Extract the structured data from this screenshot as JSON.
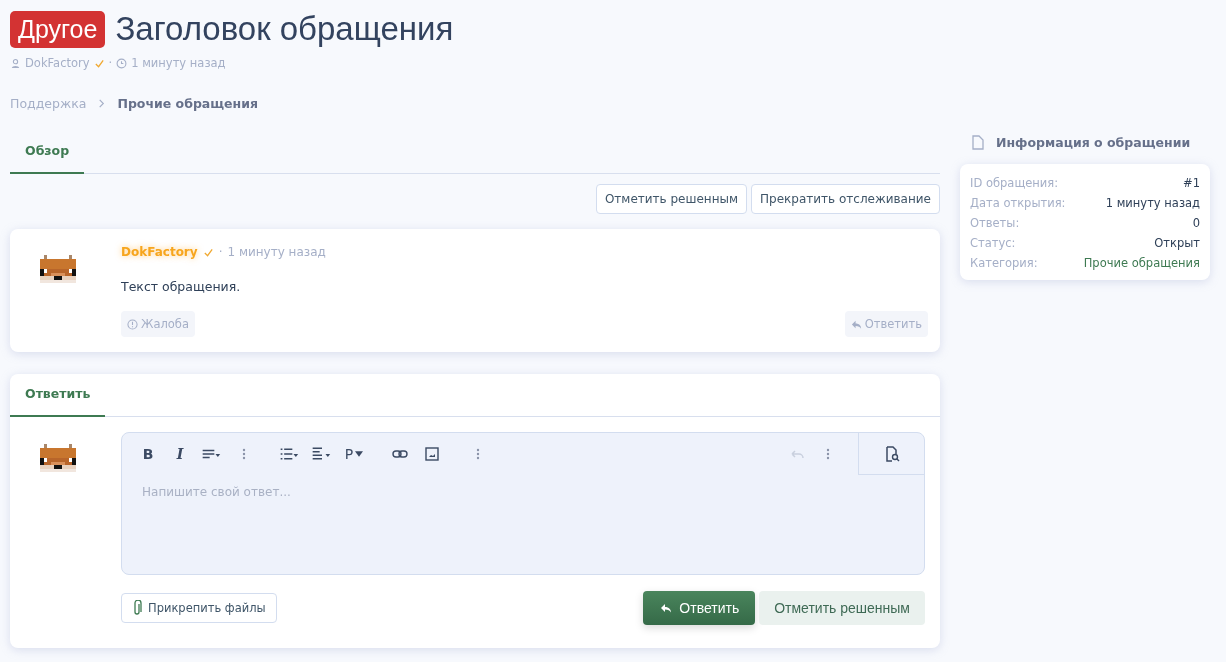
{
  "header": {
    "badge": "Другое",
    "title": "Заголовок обращения",
    "author": "DokFactory",
    "separator": "·",
    "time": "1 минуту назад"
  },
  "breadcrumb": [
    {
      "label": "Поддержка",
      "current": false
    },
    {
      "label": "Прочие обращения",
      "current": true
    }
  ],
  "tabs": [
    {
      "label": "Обзор",
      "selected": true
    }
  ],
  "actions": [
    "Отметить решенным",
    "Прекратить отслеживание"
  ],
  "post": {
    "author": "DokFactory",
    "separator": "·",
    "time": "1 минуту назад",
    "text": "Текст обращения.",
    "report": "Жалоба",
    "reply": "Ответить"
  },
  "reply_form": {
    "tabs": [
      {
        "label": "Ответить",
        "selected": true
      }
    ],
    "toolbar": [
      {
        "kind": "bold",
        "label": "B",
        "disabled": false
      },
      {
        "kind": "italic",
        "label": "I",
        "disabled": false
      },
      {
        "kind": "align",
        "disabled": false
      },
      {
        "kind": "more",
        "disabled": false
      },
      {
        "kind": "list",
        "disabled": false
      },
      {
        "kind": "justify",
        "disabled": false
      },
      {
        "kind": "paragraph",
        "label": "P",
        "disabled": false
      },
      {
        "kind": "link",
        "disabled": false
      },
      {
        "kind": "image",
        "disabled": false
      },
      {
        "kind": "more",
        "disabled": false
      },
      {
        "kind": "undo",
        "disabled": true
      },
      {
        "kind": "more",
        "disabled": false
      }
    ],
    "placeholder": "Напишите свой ответ...",
    "attach": "Прикрепить файлы",
    "submit": "Ответить",
    "resolve": "Отметить решенным"
  },
  "sidebar": {
    "title": "Информация о обращении",
    "rows": [
      {
        "label": "ID обращения:",
        "value": "#1",
        "kind": "plain"
      },
      {
        "label": "Дата открытия:",
        "value": "1 минуту назад",
        "kind": "plain"
      },
      {
        "label": "Ответы:",
        "value": "0",
        "kind": "plain"
      },
      {
        "label": "Статус:",
        "value": "Открыт",
        "kind": "plain"
      },
      {
        "label": "Категория:",
        "value": "Прочие обращения",
        "kind": "link"
      }
    ]
  }
}
